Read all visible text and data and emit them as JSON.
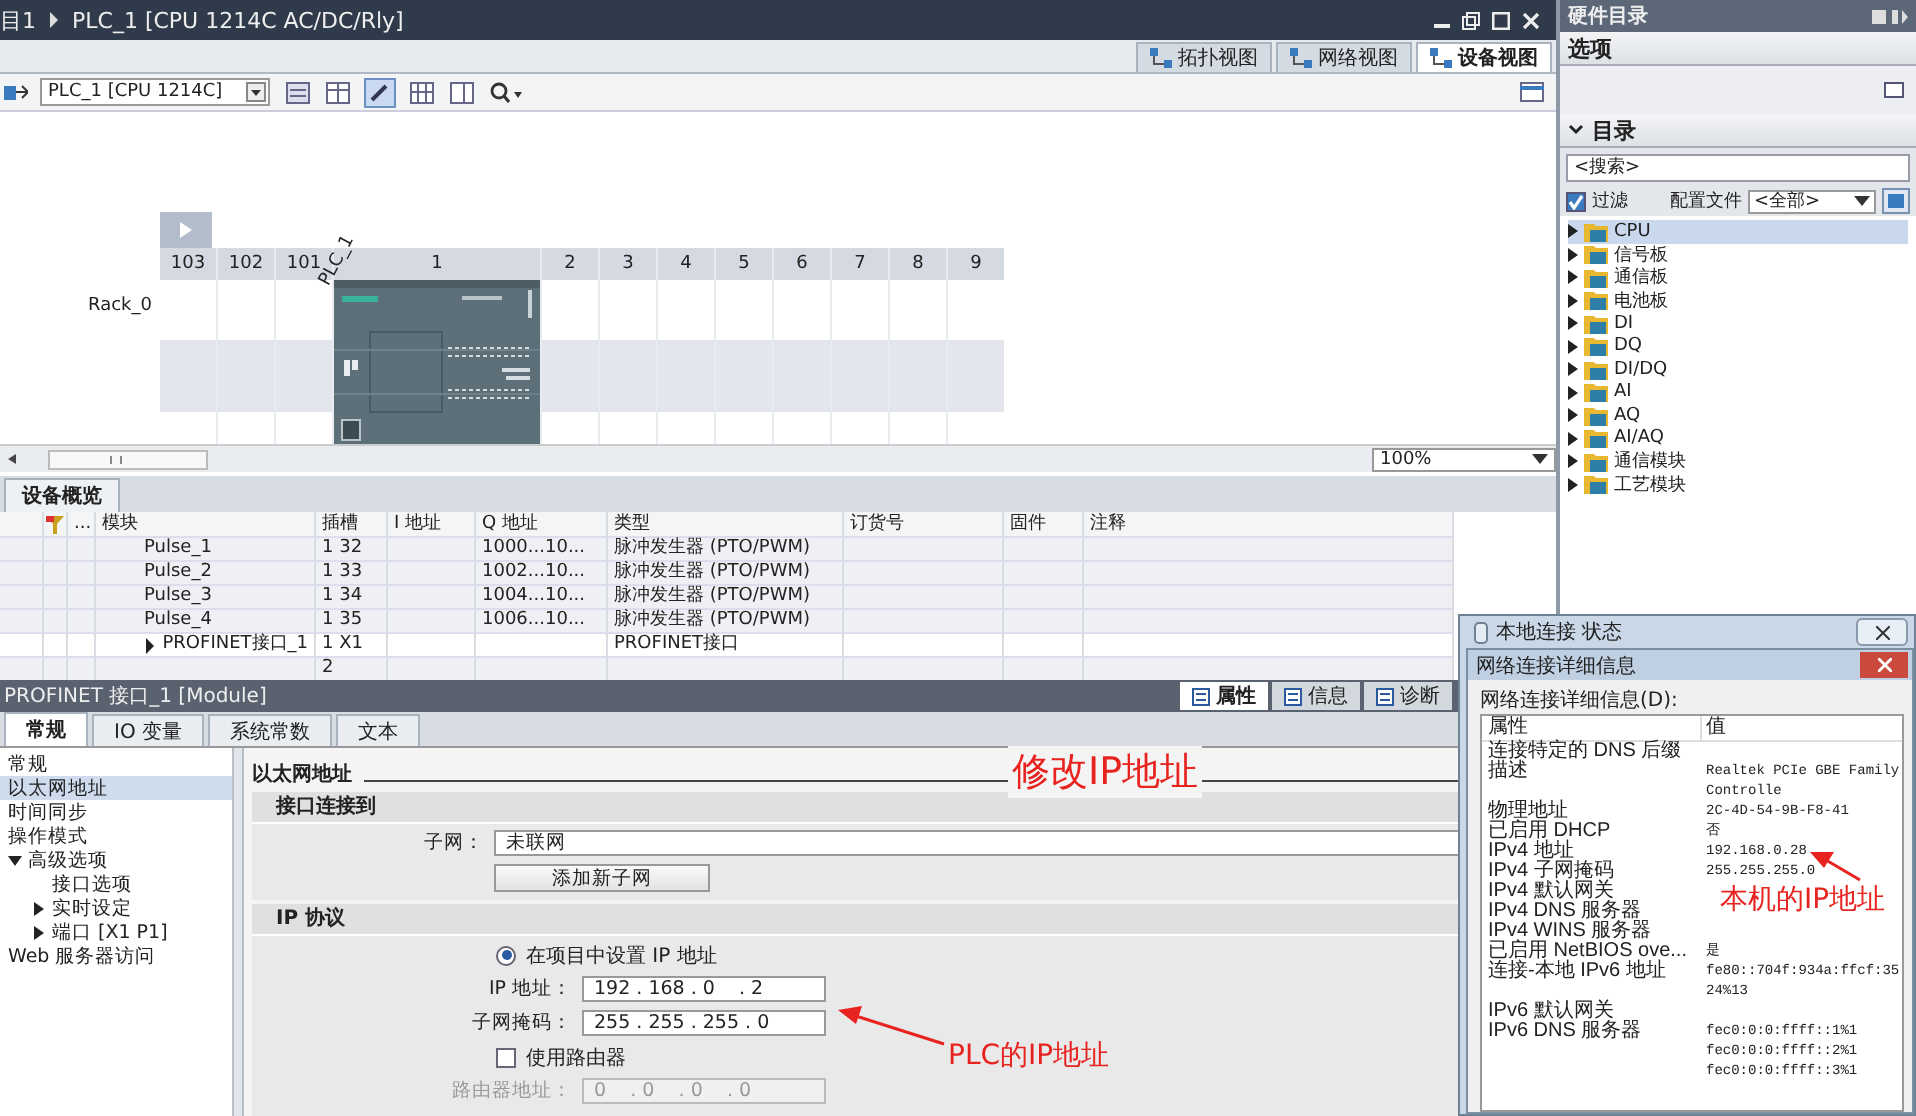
{
  "title_bar": {
    "project": "目1",
    "device": "PLC_1 [CPU 1214C AC/DC/Rly]"
  },
  "view_tabs": [
    {
      "label": "拓扑视图",
      "selected": false
    },
    {
      "label": "网络视图",
      "selected": false
    },
    {
      "label": "设备视图",
      "selected": true
    }
  ],
  "toolbar": {
    "device": "PLC_1 [CPU 1214C]"
  },
  "canvas": {
    "device_label": "PLC_1",
    "rack_label": "Rack_0",
    "slots": [
      {
        "label": "103",
        "occupied": false
      },
      {
        "label": "102",
        "occupied": false
      },
      {
        "label": "101",
        "occupied": false
      },
      {
        "label": "1",
        "occupied": true
      },
      {
        "label": "2",
        "occupied": false
      },
      {
        "label": "3",
        "occupied": false
      },
      {
        "label": "4",
        "occupied": false
      },
      {
        "label": "5",
        "occupied": false
      },
      {
        "label": "6",
        "occupied": false
      },
      {
        "label": "7",
        "occupied": false
      },
      {
        "label": "8",
        "occupied": false
      },
      {
        "label": "9",
        "occupied": false
      }
    ]
  },
  "zoom": "100%",
  "overview": {
    "tab": "设备概览",
    "more": "...",
    "columns": [
      "模块",
      "插槽",
      "I 地址",
      "Q 地址",
      "类型",
      "订货号",
      "固件",
      "注释"
    ],
    "rows": [
      {
        "module": "Pulse_1",
        "slot": "1 32",
        "q_address": "1000...10...",
        "type": "脉冲发生器 (PTO/PWM)",
        "selected": false
      },
      {
        "module": "Pulse_2",
        "slot": "1 33",
        "q_address": "1002...10...",
        "type": "脉冲发生器 (PTO/PWM)",
        "selected": false
      },
      {
        "module": "Pulse_3",
        "slot": "1 34",
        "q_address": "1004...10...",
        "type": "脉冲发生器 (PTO/PWM)",
        "selected": false
      },
      {
        "module": "Pulse_4",
        "slot": "1 35",
        "q_address": "1006...10...",
        "type": "脉冲发生器 (PTO/PWM)",
        "selected": false
      },
      {
        "module": "PROFINET接口_1",
        "slot": "1 X1",
        "type": "PROFINET接口",
        "selected": true,
        "expanded": false
      },
      {
        "slot": "2",
        "selected": false
      }
    ]
  },
  "catalog": {
    "title": "硬件目录",
    "options": "选项",
    "section": "目录",
    "search_placeholder": "<搜索>",
    "filter": {
      "label": "过滤",
      "checked": true
    },
    "profile_label": "配置文件",
    "profile": "<全部>",
    "items": [
      {
        "label": "CPU",
        "selected": true
      },
      {
        "label": "信号板",
        "selected": false
      },
      {
        "label": "通信板",
        "selected": false
      },
      {
        "label": "电池板",
        "selected": false
      },
      {
        "label": "DI",
        "selected": false
      },
      {
        "label": "DQ",
        "selected": false
      },
      {
        "label": "DI/DQ",
        "selected": false
      },
      {
        "label": "AI",
        "selected": false
      },
      {
        "label": "AQ",
        "selected": false
      },
      {
        "label": "AI/AQ",
        "selected": false
      },
      {
        "label": "通信模块",
        "selected": false
      },
      {
        "label": "工艺模块",
        "selected": false
      }
    ]
  },
  "properties": {
    "title": "PROFINET 接口_1 [Module]",
    "panel_tabs": [
      {
        "label": "属性",
        "selected": true
      },
      {
        "label": "信息",
        "selected": false
      },
      {
        "label": "诊断",
        "selected": false
      }
    ],
    "tabs": [
      {
        "label": "常规",
        "selected": true
      },
      {
        "label": "IO 变量",
        "selected": false
      },
      {
        "label": "系统常数",
        "selected": false
      },
      {
        "label": "文本",
        "selected": false
      }
    ],
    "nav": [
      {
        "label": "常规",
        "selected": false
      },
      {
        "label": "以太网地址",
        "selected": true
      },
      {
        "label": "时间同步",
        "selected": false
      },
      {
        "label": "操作模式",
        "selected": false
      },
      {
        "label": "高级选项",
        "selected": false,
        "expanded": true,
        "children": [
          {
            "label": "接口选项",
            "selected": false
          },
          {
            "label": "实时设定",
            "selected": false,
            "expanded": false
          },
          {
            "label": "端口 [X1 P1]",
            "selected": false,
            "expanded": false
          }
        ]
      },
      {
        "label": "Web 服务器访问",
        "selected": false
      }
    ],
    "heading": "以太网地址",
    "interface": {
      "heading": "接口连接到",
      "subnet_label": "子网：",
      "subnet": "未联网",
      "add_button": "添加新子网"
    },
    "ip": {
      "heading": "IP 协议",
      "set_in_project": {
        "label": "在项目中设置 IP 地址",
        "selected": true
      },
      "ip_label": "IP 地址：",
      "ip": "192 . 168 . 0    . 2",
      "mask_label": "子网掩码：",
      "mask": "255 . 255 . 255 . 0",
      "router": {
        "label": "使用路由器",
        "checked": false
      },
      "router_label": "路由器地址：",
      "router_address": "0    . 0    . 0    . 0",
      "router_disabled": true
    }
  },
  "dialog": {
    "outer_title": "本地连接 状态",
    "title": "网络连接详细信息",
    "list_label": "网络连接详细信息(D):",
    "columns": [
      "属性",
      "值"
    ],
    "rows": [
      {
        "property": "连接特定的 DNS 后缀"
      },
      {
        "property": "描述",
        "value": "Realtek PCIe GBE Family Controlle"
      },
      {
        "property": "物理地址",
        "value": "2C-4D-54-9B-F8-41"
      },
      {
        "property": "已启用 DHCP",
        "value": "否"
      },
      {
        "property": "IPv4 地址",
        "value": "192.168.0.28"
      },
      {
        "property": "IPv4 子网掩码",
        "value": "255.255.255.0"
      },
      {
        "property": "IPv4 默认网关"
      },
      {
        "property": "IPv4 DNS 服务器"
      },
      {
        "property": "IPv4 WINS 服务器"
      },
      {
        "property": "已启用 NetBIOS ove...",
        "value": "是"
      },
      {
        "property": "连接-本地 IPv6 地址",
        "value": "fe80::704f:934a:ffcf:3524%13"
      },
      {
        "property": "IPv6 默认网关"
      },
      {
        "property": "IPv6 DNS 服务器",
        "value": "fec0:0:0:ffff::1%1"
      },
      {
        "value": "fec0:0:0:ffff::2%1"
      },
      {
        "value": "fec0:0:0:ffff::3%1"
      }
    ]
  },
  "annotations": [
    {
      "text": "修改IP地址"
    },
    {
      "text": "PLC的IP地址"
    },
    {
      "text": "本机的IP地址"
    }
  ]
}
